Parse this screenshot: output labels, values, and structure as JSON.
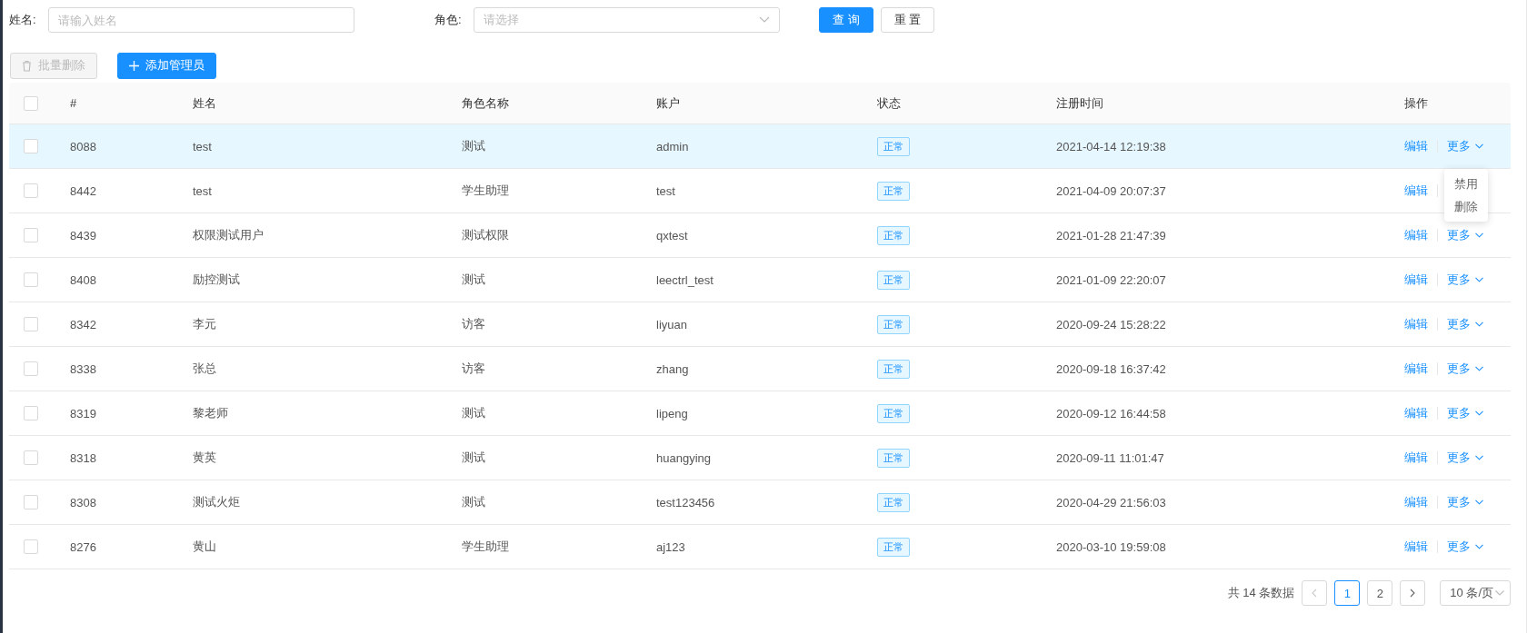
{
  "search": {
    "name_label": "姓名:",
    "name_placeholder": "请输入姓名",
    "role_label": "角色:",
    "role_placeholder": "请选择",
    "query_button": "查 询",
    "reset_button": "重 置"
  },
  "toolbar": {
    "batch_delete": {
      "label": "批量删除",
      "disabled": true
    },
    "add_button": "添加管理员"
  },
  "table": {
    "header_checked": false,
    "columns": [
      "#",
      "姓名",
      "角色名称",
      "账户",
      "状态",
      "注册时间",
      "操作"
    ],
    "rows": [
      {
        "checked": false,
        "hovered": true,
        "id": "8088",
        "name": "test",
        "role": "测试",
        "account": "admin",
        "status": "正常",
        "time": "2021-04-14 12:19:38",
        "edit": "编辑",
        "more": "更多",
        "menu": [
          "禁用",
          "删除"
        ]
      },
      {
        "checked": false,
        "hovered": false,
        "id": "8442",
        "name": "test",
        "role": "学生助理",
        "account": "test",
        "status": "正常",
        "time": "2021-04-09 20:07:37",
        "edit": "编辑"
      },
      {
        "checked": false,
        "hovered": false,
        "id": "8439",
        "name": "权限测试用户",
        "role": "测试权限",
        "account": "qxtest",
        "status": "正常",
        "time": "2021-01-28 21:47:39",
        "edit": "编辑",
        "more": "更多"
      },
      {
        "checked": false,
        "hovered": false,
        "id": "8408",
        "name": "励控测试",
        "role": "测试",
        "account": "leectrl_test",
        "status": "正常",
        "time": "2021-01-09 22:20:07",
        "edit": "编辑",
        "more": "更多"
      },
      {
        "checked": false,
        "hovered": false,
        "id": "8342",
        "name": "李元",
        "role": "访客",
        "account": "liyuan",
        "status": "正常",
        "time": "2020-09-24 15:28:22",
        "edit": "编辑",
        "more": "更多"
      },
      {
        "checked": false,
        "hovered": false,
        "id": "8338",
        "name": "张总",
        "role": "访客",
        "account": "zhang",
        "status": "正常",
        "time": "2020-09-18 16:37:42",
        "edit": "编辑",
        "more": "更多"
      },
      {
        "checked": false,
        "hovered": false,
        "id": "8319",
        "name": "黎老师",
        "role": "测试",
        "account": "lipeng",
        "status": "正常",
        "time": "2020-09-12 16:44:58",
        "edit": "编辑",
        "more": "更多"
      },
      {
        "checked": false,
        "hovered": false,
        "id": "8318",
        "name": "黄英",
        "role": "测试",
        "account": "huangying",
        "status": "正常",
        "time": "2020-09-11 11:01:47",
        "edit": "编辑",
        "more": "更多"
      },
      {
        "checked": false,
        "hovered": false,
        "id": "8308",
        "name": "测试火炬",
        "role": "测试",
        "account": "test123456",
        "status": "正常",
        "time": "2020-04-29 21:56:03",
        "edit": "编辑",
        "more": "更多"
      },
      {
        "checked": false,
        "hovered": false,
        "id": "8276",
        "name": "黄山",
        "role": "学生助理",
        "account": "aj123",
        "status": "正常",
        "time": "2020-03-10 19:59:08",
        "edit": "编辑",
        "more": "更多"
      }
    ]
  },
  "pagination": {
    "total": "共 14 条数据",
    "pages": [
      {
        "label": "1",
        "selected": true
      },
      {
        "label": "2",
        "selected": false
      }
    ],
    "page_size": "10 条/页"
  }
}
